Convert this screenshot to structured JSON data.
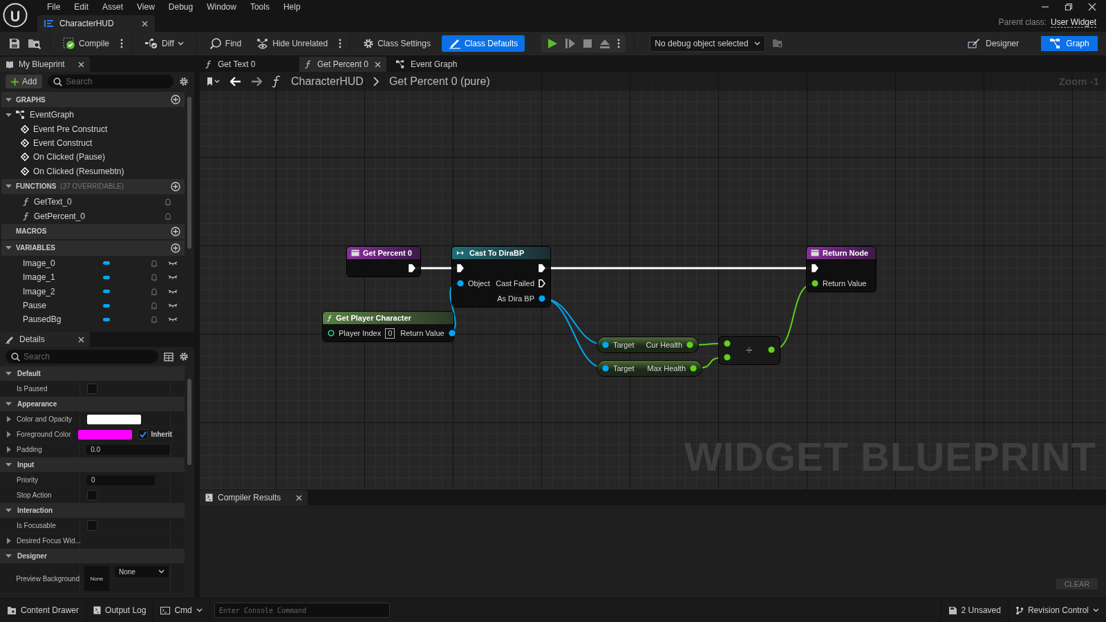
{
  "menu": [
    "File",
    "Edit",
    "Asset",
    "View",
    "Debug",
    "Window",
    "Tools",
    "Help"
  ],
  "document_tab": {
    "title": "CharacterHUD"
  },
  "parent_class": {
    "label": "Parent class:",
    "value": "User Widget"
  },
  "toolbar": {
    "buttons": [
      {
        "label": "Compile",
        "kind": "compile",
        "selected": false
      },
      {
        "label": "Diff",
        "kind": "diff",
        "selected": false
      },
      {
        "label": "Find",
        "kind": "find",
        "selected": false
      },
      {
        "label": "Hide Unrelated",
        "kind": "hide",
        "selected": false
      },
      {
        "label": "Class Settings",
        "kind": "settings",
        "selected": false
      },
      {
        "label": "Class Defaults",
        "kind": "defaults",
        "selected": true
      }
    ],
    "debug_select": "No debug object selected",
    "modes": [
      {
        "label": "Designer",
        "kind": "designer",
        "selected": false
      },
      {
        "label": "Graph",
        "kind": "graph",
        "selected": true
      }
    ]
  },
  "my_blueprint": {
    "tab": "My Blueprint",
    "add": "Add",
    "search_placeholder": "Search",
    "sections": [
      {
        "title": "GRAPHS",
        "expanded": true,
        "items": [
          {
            "label": "EventGraph",
            "kind": "graph",
            "expanded": true,
            "children": [
              {
                "label": "Event Pre Construct",
                "kind": "event"
              },
              {
                "label": "Event Construct",
                "kind": "event"
              },
              {
                "label": "On Clicked (Pause)",
                "kind": "event"
              },
              {
                "label": "On Clicked (Resumebtn)",
                "kind": "event"
              }
            ]
          }
        ]
      },
      {
        "title": "FUNCTIONS",
        "note": "(37 OVERRIDABLE)",
        "expanded": true,
        "items": [
          {
            "label": "GetText_0",
            "kind": "function"
          },
          {
            "label": "GetPercent_0",
            "kind": "function"
          }
        ]
      },
      {
        "title": "MACROS"
      },
      {
        "title": "VARIABLES",
        "expanded": true,
        "items": [
          {
            "label": "Image_0",
            "kind": "variable"
          },
          {
            "label": "Image_1",
            "kind": "variable"
          },
          {
            "label": "Image_2",
            "kind": "variable"
          },
          {
            "label": "Pause",
            "kind": "variable"
          },
          {
            "label": "PausedBg",
            "kind": "variable"
          }
        ]
      }
    ]
  },
  "details": {
    "tab": "Details",
    "search_placeholder": "Search",
    "categories": [
      {
        "name": "Default",
        "expanded": true,
        "rows": [
          {
            "label": "Is Paused",
            "kind": "checkbox",
            "checked": false
          }
        ]
      },
      {
        "name": "Appearance",
        "expanded": true,
        "rows": [
          {
            "label": "Color and Opacity",
            "kind": "color",
            "expandable": true,
            "color": "#ffffff"
          },
          {
            "label": "Foreground Color",
            "kind": "color",
            "expandable": true,
            "color": "#ff00ff",
            "inherit": {
              "label": "Inherit",
              "checked": true
            }
          },
          {
            "label": "Padding",
            "kind": "number",
            "expandable": true,
            "value": "0.0"
          }
        ]
      },
      {
        "name": "Input",
        "expanded": true,
        "rows": [
          {
            "label": "Priority",
            "kind": "number",
            "value": "0"
          },
          {
            "label": "Stop Action",
            "kind": "checkbox",
            "checked": false
          }
        ]
      },
      {
        "name": "Interaction",
        "expanded": true,
        "rows": [
          {
            "label": "Is Focusable",
            "kind": "checkbox",
            "checked": false
          },
          {
            "label": "Desired Focus Wid...",
            "kind": "plain",
            "expandable": true
          }
        ]
      },
      {
        "name": "Designer",
        "expanded": true,
        "rows": [
          {
            "label": "Preview Background",
            "kind": "asset",
            "thumbnail": "None",
            "value": "None"
          }
        ]
      }
    ]
  },
  "graph_tabs": [
    {
      "label": "Get Text 0",
      "kind": "function",
      "selected": false
    },
    {
      "label": "Get Percent 0",
      "kind": "function",
      "selected": true
    },
    {
      "label": "Event Graph",
      "kind": "graph",
      "selected": false
    }
  ],
  "breadcrumb": [
    "CharacterHUD",
    "Get Percent 0 (pure)"
  ],
  "zoom": "Zoom -1",
  "watermark": "WIDGET BLUEPRINT",
  "nodes": [
    {
      "kind": "entry",
      "title": "Get Percent 0",
      "outputs": [
        {
          "kind": "exec",
          "connected": true
        }
      ]
    },
    {
      "kind": "cast",
      "title": "Cast To DiraBP",
      "inputs": [
        {
          "kind": "exec",
          "connected": true
        },
        {
          "label": "Object",
          "kind": "object",
          "connected": true
        }
      ],
      "outputs": [
        {
          "kind": "exec",
          "connected": true
        },
        {
          "label": "Cast Failed",
          "kind": "exec",
          "connected": false
        },
        {
          "label": "As Dira BP",
          "kind": "object",
          "connected": true
        }
      ]
    },
    {
      "kind": "return",
      "title": "Return Node",
      "inputs": [
        {
          "kind": "exec",
          "connected": true
        },
        {
          "label": "Return Value",
          "kind": "float",
          "connected": true
        }
      ]
    },
    {
      "kind": "pure",
      "title": "Get Player Character",
      "inputs": [
        {
          "label": "Player Index",
          "kind": "int",
          "connected": false,
          "value": "0"
        }
      ],
      "outputs": [
        {
          "label": "Return Value",
          "kind": "object",
          "connected": true
        }
      ]
    },
    {
      "kind": "getter",
      "inputs": [
        {
          "label": "Target",
          "kind": "object",
          "connected": true
        }
      ],
      "outputs": [
        {
          "label": "Cur Health",
          "kind": "float",
          "connected": true
        }
      ]
    },
    {
      "kind": "getter",
      "inputs": [
        {
          "label": "Target",
          "kind": "object",
          "connected": true
        }
      ],
      "outputs": [
        {
          "label": "Max Health",
          "kind": "float",
          "connected": true
        }
      ]
    },
    {
      "kind": "operator",
      "symbol": "÷",
      "inputs": [
        {
          "kind": "float",
          "connected": true
        },
        {
          "kind": "float",
          "connected": true
        }
      ],
      "outputs": [
        {
          "kind": "float",
          "connected": true
        }
      ]
    }
  ],
  "compiler_results": {
    "tab": "Compiler Results",
    "clear": "CLEAR"
  },
  "status_bar": {
    "content_drawer": "Content Drawer",
    "output_log": "Output Log",
    "cmd": "Cmd",
    "console_placeholder": "Enter Console Command",
    "unsaved": "2 Unsaved",
    "revision_control": "Revision Control"
  }
}
